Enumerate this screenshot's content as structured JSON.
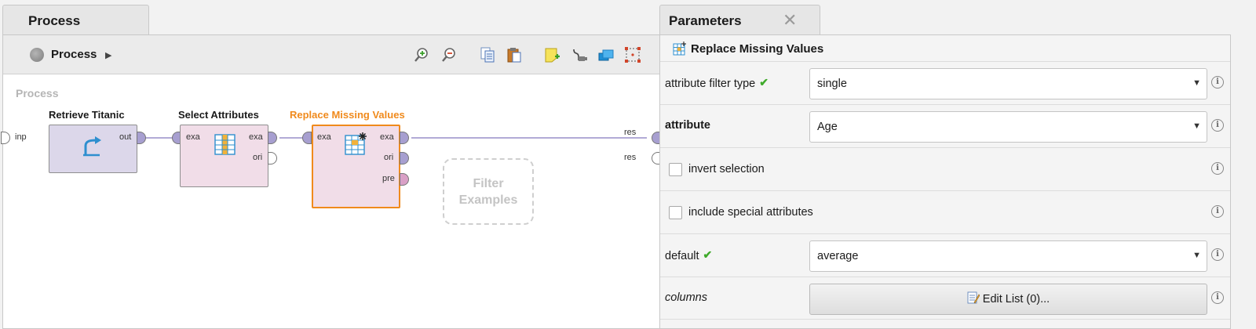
{
  "process_panel": {
    "tab_label": "Process",
    "breadcrumb_label": "Process",
    "canvas_title": "Process",
    "input_port_label": "inp",
    "result_port_1_label": "res",
    "result_port_2_label": "res",
    "toolbar_icons": [
      "zoom-in-icon",
      "zoom-out-icon",
      "copy-icon",
      "paste-icon",
      "add-note-icon",
      "auto-wire-icon",
      "layers-icon",
      "fit-view-icon"
    ],
    "operators": [
      {
        "title": "Retrieve Titanic",
        "out_port": "out",
        "color": "#dcd7ea"
      },
      {
        "title": "Select Attributes",
        "in_port": "exa",
        "out_port_1": "exa",
        "out_port_2": "ori",
        "color": "#f1dde8"
      },
      {
        "title": "Replace Missing Values",
        "in_port": "exa",
        "out_port_1": "exa",
        "out_port_2": "ori",
        "out_port_3": "pre",
        "color": "#f1dde8",
        "selected": true,
        "selected_color": "#f08a1c"
      }
    ],
    "ghost_operator": {
      "line1": "Filter",
      "line2": "Examples"
    }
  },
  "parameters_panel": {
    "tab_label": "Parameters",
    "operator_name": "Replace Missing Values",
    "rows": {
      "attribute_filter_type": {
        "label": "attribute filter type",
        "value": "single"
      },
      "attribute": {
        "label": "attribute",
        "value": "Age"
      },
      "invert_selection": {
        "label": "invert selection",
        "checked": false
      },
      "include_special_attributes": {
        "label": "include special attributes",
        "checked": false
      },
      "default": {
        "label": "default",
        "value": "average"
      },
      "columns": {
        "label": "columns",
        "button_label": "Edit List (0)..."
      }
    }
  },
  "colors": {
    "connection": "#a79fd0",
    "expert_chevron": "#3faa2b",
    "selected_operator": "#f08a1c"
  }
}
